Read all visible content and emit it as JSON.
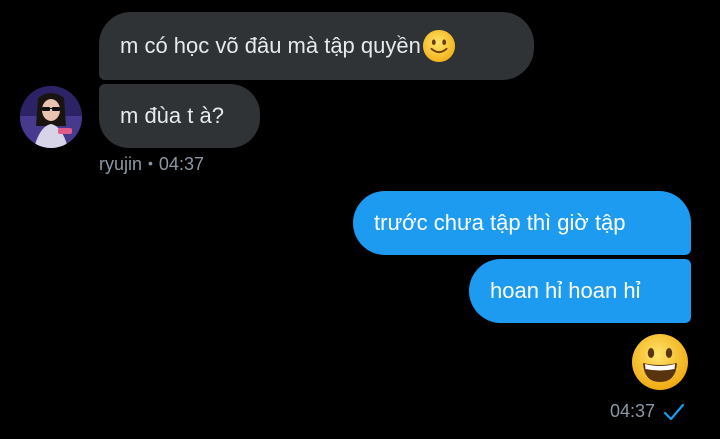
{
  "conversation": {
    "received": [
      {
        "text": "m có học võ đâu mà tập quyền",
        "trailing_emoji": "slightly-smiling-face-icon"
      },
      {
        "text": "m đùa t à?"
      }
    ],
    "received_meta": {
      "sender": "ryujin",
      "separator": "•",
      "time": "04:37"
    },
    "sent": [
      {
        "text": "trước chưa tập thì giờ tập"
      },
      {
        "text": "hoan hỉ hoan hỉ"
      }
    ],
    "sent_emoji": "grinning-face-icon",
    "sent_meta": {
      "time": "04:37",
      "status_icon": "read-checkmark-icon"
    }
  },
  "colors": {
    "background": "#000000",
    "received_bubble": "#2f3336",
    "sent_bubble": "#1d9bf0",
    "meta_text": "#8b98a5",
    "check": "#1d9bf0"
  }
}
